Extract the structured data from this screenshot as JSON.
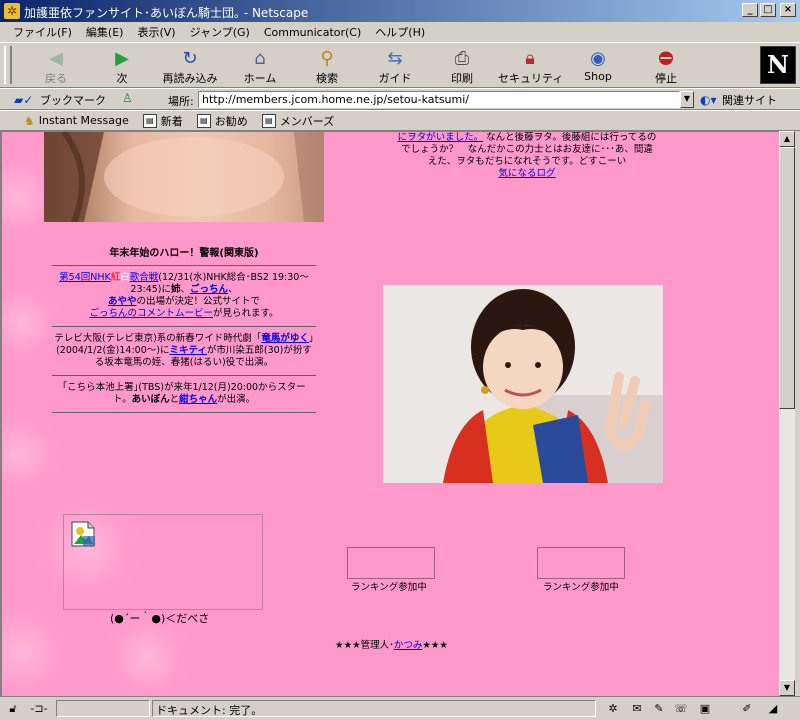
{
  "window": {
    "title": "加護亜依ファンサイト･あいぼん騎士団｡ - Netscape",
    "buttons": [
      "_",
      "□",
      "×"
    ]
  },
  "menubar": [
    "ファイル(F)",
    "編集(E)",
    "表示(V)",
    "ジャンプ(G)",
    "Communicator(C)",
    "ヘルプ(H)"
  ],
  "toolbar": {
    "back": "戻る",
    "forward": "次",
    "reload": "再読み込み",
    "home": "ホーム",
    "search": "検索",
    "guide": "ガイド",
    "print": "印刷",
    "security": "セキュリティ",
    "shop": "Shop",
    "stop": "停止",
    "logo": "N"
  },
  "location": {
    "bookmarks": "ブックマーク",
    "label": "場所:",
    "url": "http://members.jcom.home.ne.jp/setou-katsumi/",
    "related": "関連サイト"
  },
  "personal_toolbar": [
    "Instant Message",
    "新着",
    "お勧め",
    "メンバーズ"
  ],
  "page": {
    "side_text": {
      "line1_pre": "にヲタがいました。",
      "line1_post": " なんと後藤ヲタ。後藤組には行ってるの",
      "line2": "でしょうか？　なんだかこの力士とはお友達に･･･あ、間違",
      "line3": "えた、ヲタもだちになれそうです。どすこーい",
      "link": "気になるログ"
    },
    "news": {
      "title": "年末年始のハロー！警報(関東版)",
      "item1": {
        "link1": "第54回NHK",
        "red1": "紅",
        "white1": "白",
        "link2": "歌合戦",
        "text1": "(12/31(水)NHK総合･BS2 19:30～23:45)に",
        "bold1": "姉",
        "text2": "、",
        "link3": "ごっちん",
        "text3": "、",
        "link4": "あやや",
        "text4": "の出場が決定！公式サイトで",
        "link5": "ごっちんのコメントムービー",
        "text5": "が見られます。"
      },
      "item2": {
        "text1": "テレビ大阪(テレビ東京)系の新春ワイド時代劇「",
        "link1": "竜馬がゆく",
        "text2": "」(2004/1/2(金)14:00～)に",
        "link2": "ミキティ",
        "text3": "が市川染五郎(30)が扮する坂本竜馬の姪、春猪(はるい)役で出演。"
      },
      "item3": {
        "text1": "｢こちら本池上署｣(TBS)が来年1/12(月)20:00からスタート。",
        "bold1": "あいぼん",
        "text2": "と",
        "link1": "紺ちゃん",
        "text3": "が出演。"
      }
    },
    "emoticon": "(●´ー｀●)＜だべさ",
    "ranking1": "ランキング参加中",
    "ranking2": "ランキング参加中",
    "admin_pre": "★★★管理人･",
    "admin_link": "かつみ",
    "admin_post": "★★★"
  },
  "status": {
    "text": "ドキュメント: 完了。"
  },
  "colors": {
    "page_bg": "#ff99cc",
    "link": "#0000ee",
    "titlebar_start": "#0a246a",
    "titlebar_end": "#a6caf0"
  }
}
